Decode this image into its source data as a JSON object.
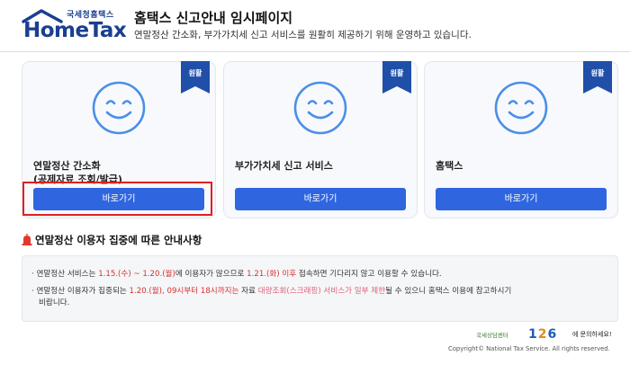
{
  "header": {
    "logo_sub": "국세청홈택스",
    "logo_main": "HomeTax",
    "title": "홈택스 신고안내 임시페이지",
    "description": "연말정산 간소화, 부가가치세 신고 서비스를 원활히 제공하기 위해 운영하고 있습니다."
  },
  "cards": [
    {
      "badge": "원활",
      "title": "연말정산 간소화",
      "subtitle": "(공제자료 조회/발급)",
      "button": "바로가기"
    },
    {
      "badge": "원활",
      "title": "부가가치세 신고 서비스",
      "subtitle": "",
      "button": "바로가기"
    },
    {
      "badge": "원활",
      "title": "홈택스",
      "subtitle": "",
      "button": "바로가기"
    }
  ],
  "notice": {
    "title": "연말정산 이용자 집중에 따른 안내사항",
    "line1": {
      "a": "· 연말정산 서비스는 ",
      "b": "1.15.(수) ~ 1.20.(월)",
      "c": "에 이용자가 많으므로 ",
      "d": "1.21.(화) 이후",
      "e": " 접속하면 기다리지 않고 이용할 수 있습니다."
    },
    "line2": {
      "a": "· 연말정산 이용자가 집중되는 ",
      "b": "1.20.(월), 09시부터 18시까지는",
      "c": " 자료 ",
      "d": "대량조회(스크래핑) 서비스가 일부 제한",
      "e": "될 수 있으니 홈택스 이용에 참고하시기"
    },
    "line2b": "비랍니다."
  },
  "footer": {
    "cta_small": "국세상담센터",
    "cta_d1": "1",
    "cta_d2": "2",
    "cta_d3": "6",
    "cta_text": "에 문의하세요!",
    "copyright": "Copyright© National Tax Service. All rights reserved."
  },
  "colors": {
    "brand": "#1a3f8f",
    "button": "#2f66e0",
    "badge": "#1f4fa8",
    "highlight": "#d8302f",
    "outline": "#e02020"
  }
}
